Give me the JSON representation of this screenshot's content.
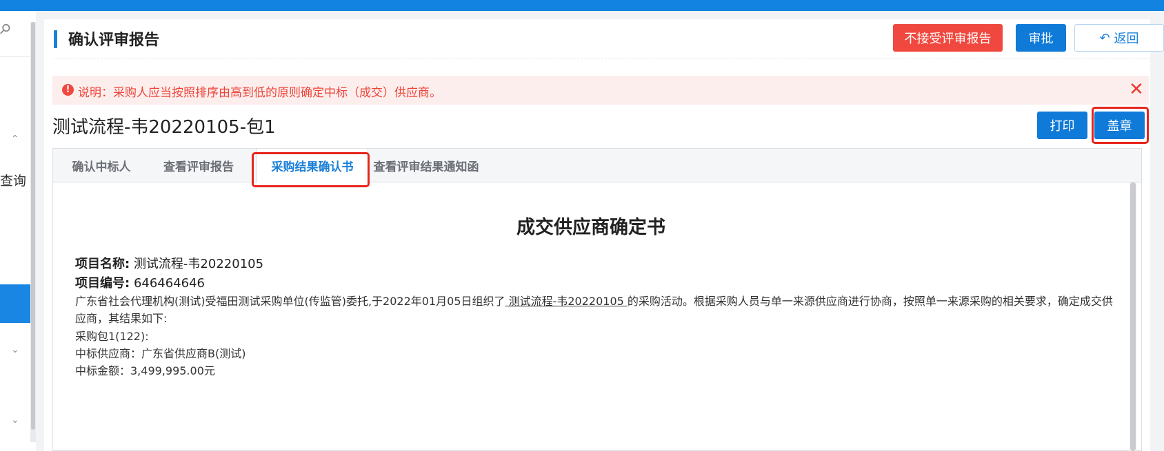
{
  "header": {
    "title": "确认评审报告",
    "reject_label": "不接受评审报告",
    "approve_label": "审批",
    "back_label": "返回"
  },
  "sidebar": {
    "partial_label": "查询"
  },
  "alert": {
    "icon": "!",
    "text": "说明：采购人应当按照排序由高到低的原则确定中标（成交）供应商。"
  },
  "project": {
    "title": "测试流程-韦20220105-包1",
    "print_label": "打印",
    "seal_label": "盖章"
  },
  "tabs": [
    {
      "label": "确认中标人"
    },
    {
      "label": "查看评审报告"
    },
    {
      "label": "采购结果确认书",
      "active": true
    },
    {
      "label": "查看评审结果通知函"
    }
  ],
  "document": {
    "title": "成交供应商确定书",
    "project_name_label": "项目名称:",
    "project_name": "测试流程-韦20220105",
    "project_no_label": "项目编号:",
    "project_no": "646464646",
    "body_prefix": "广东省社会代理机构(测试)受福田测试采购单位(传监管)委托,于2022年01月05日组织了",
    "body_project": " 测试流程-韦20220105 ",
    "body_suffix": "的采购活动。根据采购人员与单一来源供应商进行协商，按照单一来源采购的相关要求，确定成交供应商，其结果如下:",
    "package": "采购包1(122):",
    "supplier": "中标供应商：广东省供应商B(测试)",
    "amount": "中标金额：3,499,995.00元"
  },
  "colors": {
    "topbar": "#1283e0",
    "primary": "#0f7ad8",
    "danger": "#f0483e",
    "highlight": "#e8231c"
  }
}
